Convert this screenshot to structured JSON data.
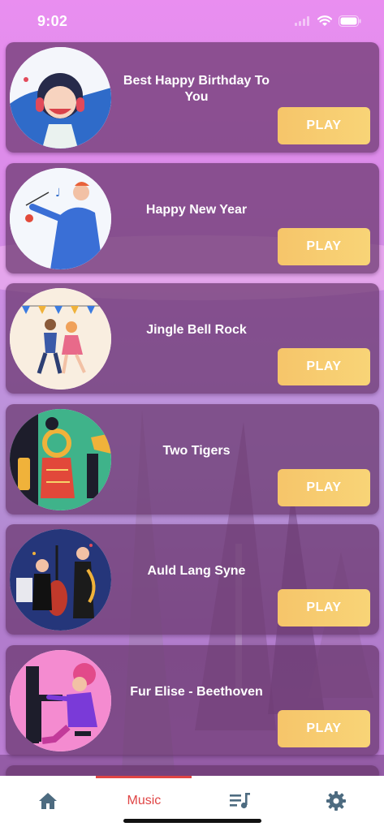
{
  "status_bar": {
    "time": "9:02"
  },
  "songs": [
    {
      "title": "Best Happy Birthday To You",
      "play_label": "PLAY",
      "image": "girl-headphones"
    },
    {
      "title": "Happy New Year",
      "play_label": "PLAY",
      "image": "conductor"
    },
    {
      "title": "Jingle Bell Rock",
      "play_label": "PLAY",
      "image": "dancing-couple"
    },
    {
      "title": "Two Tigers",
      "play_label": "PLAY",
      "image": "brass-musicians"
    },
    {
      "title": "Auld Lang Syne",
      "play_label": "PLAY",
      "image": "jazz-band"
    },
    {
      "title": "Fur Elise - Beethoven",
      "play_label": "PLAY",
      "image": "pianist"
    }
  ],
  "tabbar": {
    "tabs": [
      {
        "icon": "home-icon"
      },
      {
        "label": "Music",
        "active": true
      },
      {
        "icon": "playlist-icon"
      },
      {
        "icon": "gear-icon"
      }
    ]
  },
  "colors": {
    "accent": "#e04545",
    "play_button": "#f7cc70",
    "card": "#69376e"
  }
}
